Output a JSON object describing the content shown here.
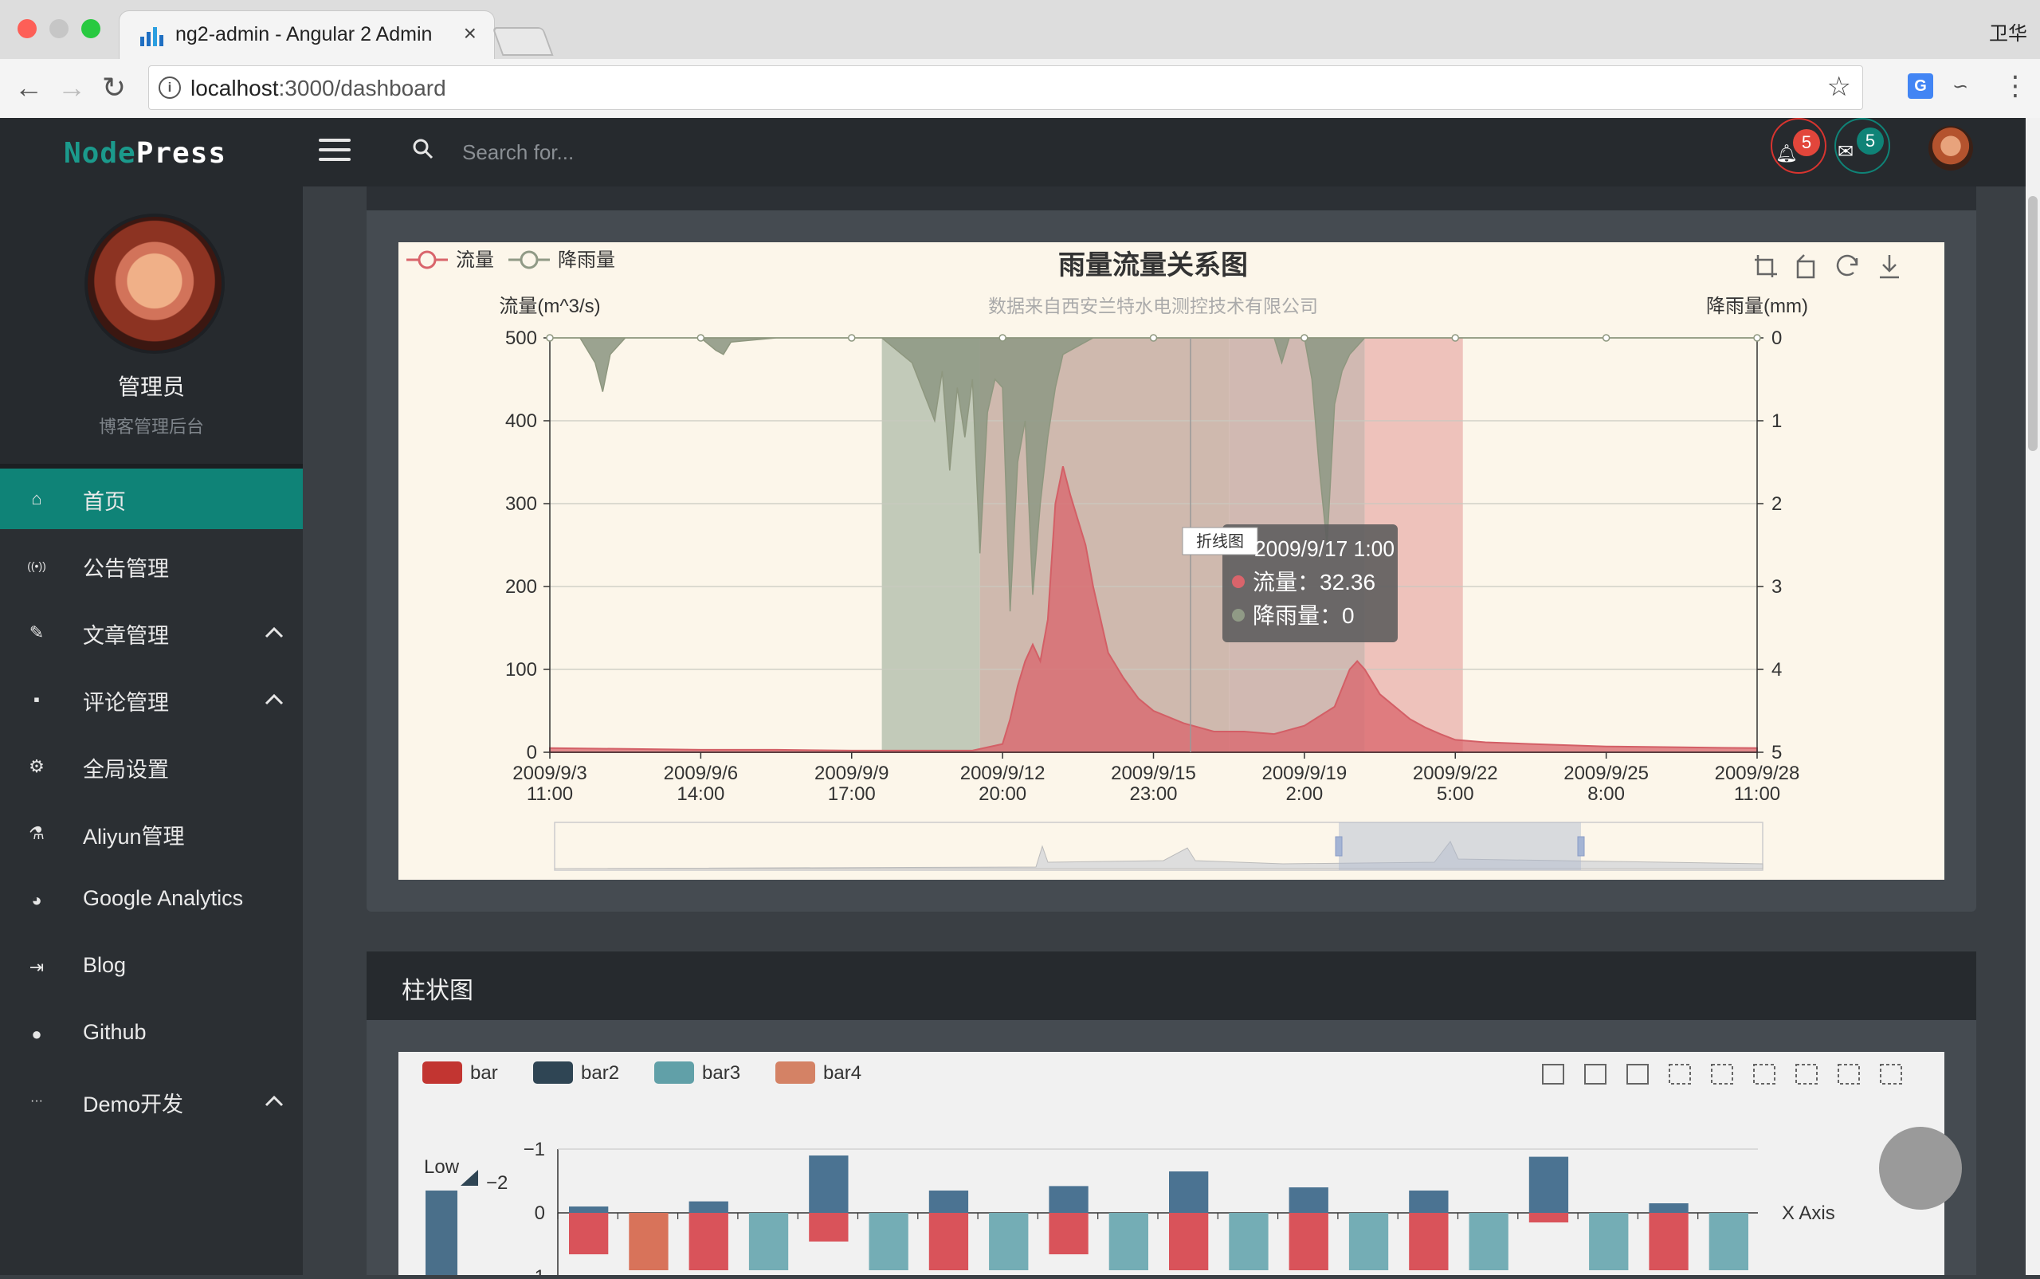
{
  "browser": {
    "tab_title": "ng2-admin - Angular 2 Admin",
    "tab_close": "×",
    "url_host": "localhost",
    "url_path": ":3000/dashboard",
    "profile": "卫华"
  },
  "header": {
    "brand_left": "Node",
    "brand_right": "Press",
    "search_placeholder": "Search for...",
    "notifications_count": "5",
    "messages_count": "5"
  },
  "sidebar": {
    "profile_name": "管理员",
    "profile_subtitle": "博客管理后台",
    "items": [
      {
        "label": "首页",
        "icon": "home-icon",
        "glyph": "⌂"
      },
      {
        "label": "公告管理",
        "icon": "broadcast-icon",
        "glyph": "((•))"
      },
      {
        "label": "文章管理",
        "icon": "pin-icon",
        "glyph": "✎"
      },
      {
        "label": "评论管理",
        "icon": "comment-icon",
        "glyph": "▪"
      },
      {
        "label": "全局设置",
        "icon": "gear-icon",
        "glyph": "⚙"
      },
      {
        "label": "Aliyun管理",
        "icon": "flask-icon",
        "glyph": "⚗"
      },
      {
        "label": "Google Analytics",
        "icon": "pie-chart-icon",
        "glyph": "◕"
      },
      {
        "label": "Blog",
        "icon": "sign-in-icon",
        "glyph": "⇥"
      },
      {
        "label": "Github",
        "icon": "github-icon",
        "glyph": "●"
      },
      {
        "label": "Demo开发",
        "icon": "ellipsis-icon",
        "glyph": "···"
      }
    ]
  },
  "chart1": {
    "title": "雨量流量关系图",
    "subtitle": "数据来自西安兰特水电测控技术有限公司",
    "legend": [
      "流量",
      "降雨量"
    ],
    "tooltip": {
      "badge": "折线图",
      "time": "2009/9/17 1:00",
      "rows": [
        "流量：32.36",
        "降雨量：0"
      ]
    }
  },
  "chart_data": [
    {
      "type": "line",
      "title": "雨量流量关系图",
      "subtitle": "数据来自西安兰特水电测控技术有限公司",
      "ylabel": "流量(m^3/s)",
      "y2label": "降雨量(mm)",
      "ylim": [
        0,
        500
      ],
      "y2lim": [
        5,
        0
      ],
      "yticks": [
        "500",
        "400",
        "300",
        "200",
        "100",
        "0"
      ],
      "y2ticks": [
        "0",
        "1",
        "2",
        "3",
        "4",
        "5"
      ],
      "xticks": [
        [
          "2009/9/3",
          "11:00"
        ],
        [
          "2009/9/6",
          "14:00"
        ],
        [
          "2009/9/9",
          "17:00"
        ],
        [
          "2009/9/12",
          "20:00"
        ],
        [
          "2009/9/15",
          "23:00"
        ],
        [
          "2009/9/19",
          "2:00"
        ],
        [
          "2009/9/22",
          "5:00"
        ],
        [
          "2009/9/25",
          "8:00"
        ],
        [
          "2009/9/28",
          "11:00"
        ]
      ],
      "series": [
        {
          "name": "流量",
          "color": "#d9646b",
          "x": [
            0,
            0.5,
            1,
            1.5,
            2,
            2.5,
            2.8,
            3,
            3.05,
            3.1,
            3.15,
            3.2,
            3.25,
            3.3,
            3.35,
            3.4,
            3.45,
            3.5,
            3.55,
            3.6,
            3.7,
            3.8,
            3.9,
            4,
            4.2,
            4.4,
            4.6,
            4.8,
            5,
            5.2,
            5.3,
            5.35,
            5.4,
            5.5,
            5.6,
            5.7,
            5.8,
            5.9,
            6,
            6.2,
            6.5,
            7,
            7.5,
            8
          ],
          "values": [
            5,
            4,
            3,
            3,
            2,
            2,
            2,
            10,
            40,
            80,
            110,
            130,
            110,
            160,
            300,
            345,
            310,
            280,
            250,
            200,
            120,
            90,
            65,
            50,
            35,
            25,
            25,
            22,
            32,
            55,
            100,
            110,
            100,
            70,
            55,
            40,
            30,
            22,
            15,
            12,
            10,
            7,
            6,
            5
          ]
        },
        {
          "name": "降雨量",
          "color": "#909a86",
          "x": [
            0,
            0.2,
            0.3,
            0.35,
            0.4,
            0.5,
            1,
            1.1,
            1.15,
            1.2,
            1.5,
            2,
            2.2,
            2.4,
            2.55,
            2.6,
            2.65,
            2.7,
            2.75,
            2.8,
            2.85,
            2.9,
            2.95,
            3,
            3.05,
            3.1,
            3.15,
            3.2,
            3.25,
            3.3,
            3.35,
            3.4,
            3.5,
            3.6,
            3.7,
            4,
            4.5,
            4.8,
            4.85,
            4.9,
            4.95,
            5,
            5.05,
            5.1,
            5.15,
            5.2,
            5.25,
            5.3,
            5.4,
            6,
            7,
            8
          ],
          "values": [
            0,
            0,
            0.3,
            0.65,
            0.2,
            0,
            0,
            0.15,
            0.2,
            0.05,
            0,
            0,
            0,
            0.3,
            1.0,
            0.4,
            1.6,
            0.6,
            1.2,
            0.5,
            2.6,
            0.9,
            0.5,
            0.6,
            3.3,
            1.5,
            1.0,
            3.1,
            2.0,
            1.2,
            0.6,
            0.2,
            0.1,
            0,
            0,
            0,
            0,
            0,
            0.3,
            0,
            0,
            0,
            0.5,
            1.6,
            2.5,
            0.8,
            0.4,
            0.2,
            0,
            0,
            0,
            0
          ]
        }
      ],
      "bands": [
        {
          "from": 2.2,
          "to": 2.85,
          "color": "#b7c2b0"
        },
        {
          "from": 2.85,
          "to": 4.5,
          "color": "#c7aea3"
        },
        {
          "from": 4.5,
          "to": 5.4,
          "color": "#c9aea8"
        },
        {
          "from": 5.4,
          "to": 6.05,
          "color": "#ebb9b3"
        }
      ],
      "tooltip_x": 4.35
    },
    {
      "type": "bar",
      "title": "柱状图",
      "legend": [
        {
          "name": "bar",
          "color": "#c23531"
        },
        {
          "name": "bar2",
          "color": "#2f4554"
        },
        {
          "name": "bar3",
          "color": "#61a0a8"
        },
        {
          "name": "bar4",
          "color": "#d48265"
        }
      ],
      "x_axis_label": "X Axis",
      "yticks": [
        "−1",
        "0",
        "1"
      ],
      "ylim": [
        -1,
        1
      ],
      "visual_map_labels": {
        "low": "Low",
        "value": "−2"
      },
      "groups": [
        {
          "bar2": 0.1,
          "bar": -0.65,
          "bar3": 0,
          "bar4": 0
        },
        {
          "bar2": 0,
          "bar4": -0.9,
          "bar3": 0,
          "bar": 0
        },
        {
          "bar2": 0.18,
          "bar": -0.9,
          "bar3": 0,
          "bar4": 0
        },
        {
          "bar2": 0,
          "bar": 0,
          "bar3": -0.9,
          "bar4": 0
        },
        {
          "bar2": 0.9,
          "bar": -0.45,
          "bar3": 0,
          "bar4": 0
        },
        {
          "bar2": 0,
          "bar": 0,
          "bar3": -0.9,
          "bar4": 0
        },
        {
          "bar2": 0.35,
          "bar": -0.9,
          "bar3": 0,
          "bar4": 0
        },
        {
          "bar2": 0,
          "bar": 0,
          "bar3": -0.9,
          "bar4": 0
        },
        {
          "bar2": 0.42,
          "bar": -0.65,
          "bar3": 0,
          "bar4": 0
        },
        {
          "bar2": 0,
          "bar": 0,
          "bar3": -0.9,
          "bar4": 0
        },
        {
          "bar2": 0.65,
          "bar": -0.9,
          "bar3": 0,
          "bar4": 0
        },
        {
          "bar2": 0,
          "bar": 0,
          "bar3": -0.9,
          "bar4": 0
        },
        {
          "bar2": 0.4,
          "bar": -0.9,
          "bar3": 0,
          "bar4": 0
        },
        {
          "bar2": 0,
          "bar": 0,
          "bar3": -0.9,
          "bar4": 0
        },
        {
          "bar2": 0.35,
          "bar": -0.9,
          "bar3": 0,
          "bar4": 0
        },
        {
          "bar2": 0,
          "bar": 0,
          "bar3": -0.9,
          "bar4": 0
        },
        {
          "bar2": 0.88,
          "bar": -0.15,
          "bar3": 0,
          "bar4": 0
        },
        {
          "bar2": 0,
          "bar": 0,
          "bar3": -0.9,
          "bar4": 0
        },
        {
          "bar2": 0.15,
          "bar": -0.9,
          "bar3": 0,
          "bar4": 0
        },
        {
          "bar2": 0,
          "bar": 0,
          "bar3": -0.9,
          "bar4": 0
        }
      ]
    }
  ],
  "section2": {
    "title": "柱状图"
  }
}
